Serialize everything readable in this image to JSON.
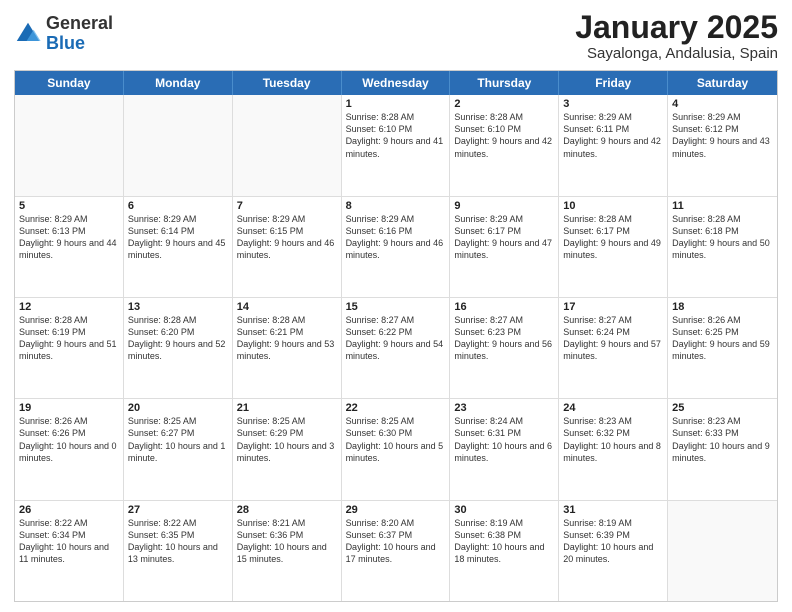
{
  "header": {
    "logo": {
      "general": "General",
      "blue": "Blue"
    },
    "title": "January 2025",
    "location": "Sayalonga, Andalusia, Spain"
  },
  "calendar": {
    "days": [
      "Sunday",
      "Monday",
      "Tuesday",
      "Wednesday",
      "Thursday",
      "Friday",
      "Saturday"
    ],
    "rows": [
      [
        {
          "day": "",
          "empty": true
        },
        {
          "day": "",
          "empty": true
        },
        {
          "day": "",
          "empty": true
        },
        {
          "day": "1",
          "sunrise": "8:28 AM",
          "sunset": "6:10 PM",
          "daylight": "9 hours and 41 minutes."
        },
        {
          "day": "2",
          "sunrise": "8:28 AM",
          "sunset": "6:10 PM",
          "daylight": "9 hours and 42 minutes."
        },
        {
          "day": "3",
          "sunrise": "8:29 AM",
          "sunset": "6:11 PM",
          "daylight": "9 hours and 42 minutes."
        },
        {
          "day": "4",
          "sunrise": "8:29 AM",
          "sunset": "6:12 PM",
          "daylight": "9 hours and 43 minutes."
        }
      ],
      [
        {
          "day": "5",
          "sunrise": "8:29 AM",
          "sunset": "6:13 PM",
          "daylight": "9 hours and 44 minutes."
        },
        {
          "day": "6",
          "sunrise": "8:29 AM",
          "sunset": "6:14 PM",
          "daylight": "9 hours and 45 minutes."
        },
        {
          "day": "7",
          "sunrise": "8:29 AM",
          "sunset": "6:15 PM",
          "daylight": "9 hours and 46 minutes."
        },
        {
          "day": "8",
          "sunrise": "8:29 AM",
          "sunset": "6:16 PM",
          "daylight": "9 hours and 46 minutes."
        },
        {
          "day": "9",
          "sunrise": "8:29 AM",
          "sunset": "6:17 PM",
          "daylight": "9 hours and 47 minutes."
        },
        {
          "day": "10",
          "sunrise": "8:28 AM",
          "sunset": "6:17 PM",
          "daylight": "9 hours and 49 minutes."
        },
        {
          "day": "11",
          "sunrise": "8:28 AM",
          "sunset": "6:18 PM",
          "daylight": "9 hours and 50 minutes."
        }
      ],
      [
        {
          "day": "12",
          "sunrise": "8:28 AM",
          "sunset": "6:19 PM",
          "daylight": "9 hours and 51 minutes."
        },
        {
          "day": "13",
          "sunrise": "8:28 AM",
          "sunset": "6:20 PM",
          "daylight": "9 hours and 52 minutes."
        },
        {
          "day": "14",
          "sunrise": "8:28 AM",
          "sunset": "6:21 PM",
          "daylight": "9 hours and 53 minutes."
        },
        {
          "day": "15",
          "sunrise": "8:27 AM",
          "sunset": "6:22 PM",
          "daylight": "9 hours and 54 minutes."
        },
        {
          "day": "16",
          "sunrise": "8:27 AM",
          "sunset": "6:23 PM",
          "daylight": "9 hours and 56 minutes."
        },
        {
          "day": "17",
          "sunrise": "8:27 AM",
          "sunset": "6:24 PM",
          "daylight": "9 hours and 57 minutes."
        },
        {
          "day": "18",
          "sunrise": "8:26 AM",
          "sunset": "6:25 PM",
          "daylight": "9 hours and 59 minutes."
        }
      ],
      [
        {
          "day": "19",
          "sunrise": "8:26 AM",
          "sunset": "6:26 PM",
          "daylight": "10 hours and 0 minutes."
        },
        {
          "day": "20",
          "sunrise": "8:25 AM",
          "sunset": "6:27 PM",
          "daylight": "10 hours and 1 minute."
        },
        {
          "day": "21",
          "sunrise": "8:25 AM",
          "sunset": "6:29 PM",
          "daylight": "10 hours and 3 minutes."
        },
        {
          "day": "22",
          "sunrise": "8:25 AM",
          "sunset": "6:30 PM",
          "daylight": "10 hours and 5 minutes."
        },
        {
          "day": "23",
          "sunrise": "8:24 AM",
          "sunset": "6:31 PM",
          "daylight": "10 hours and 6 minutes."
        },
        {
          "day": "24",
          "sunrise": "8:23 AM",
          "sunset": "6:32 PM",
          "daylight": "10 hours and 8 minutes."
        },
        {
          "day": "25",
          "sunrise": "8:23 AM",
          "sunset": "6:33 PM",
          "daylight": "10 hours and 9 minutes."
        }
      ],
      [
        {
          "day": "26",
          "sunrise": "8:22 AM",
          "sunset": "6:34 PM",
          "daylight": "10 hours and 11 minutes."
        },
        {
          "day": "27",
          "sunrise": "8:22 AM",
          "sunset": "6:35 PM",
          "daylight": "10 hours and 13 minutes."
        },
        {
          "day": "28",
          "sunrise": "8:21 AM",
          "sunset": "6:36 PM",
          "daylight": "10 hours and 15 minutes."
        },
        {
          "day": "29",
          "sunrise": "8:20 AM",
          "sunset": "6:37 PM",
          "daylight": "10 hours and 17 minutes."
        },
        {
          "day": "30",
          "sunrise": "8:19 AM",
          "sunset": "6:38 PM",
          "daylight": "10 hours and 18 minutes."
        },
        {
          "day": "31",
          "sunrise": "8:19 AM",
          "sunset": "6:39 PM",
          "daylight": "10 hours and 20 minutes."
        },
        {
          "day": "",
          "empty": true
        }
      ]
    ]
  }
}
